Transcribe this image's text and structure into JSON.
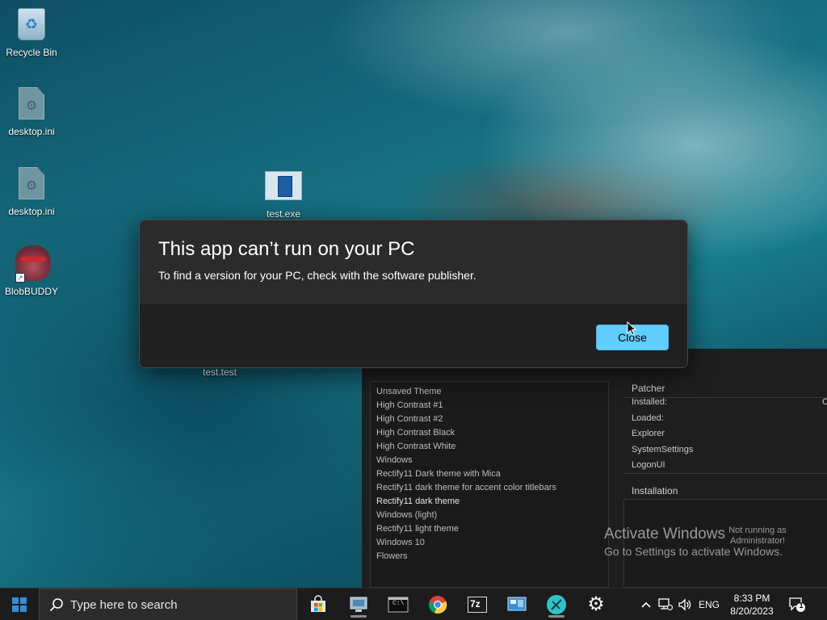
{
  "desktop": {
    "icons": [
      {
        "label": "Recycle Bin",
        "icon": "recycle-bin-icon"
      },
      {
        "label": "desktop.ini",
        "icon": "settings-file-icon"
      },
      {
        "label": "desktop.ini",
        "icon": "settings-file-icon"
      },
      {
        "label": "BlobBUDDY",
        "icon": "blobbuddy-icon"
      },
      {
        "label": "test.exe",
        "icon": "exe-file-icon"
      },
      {
        "label": "test.test",
        "icon": "unknown-file-icon"
      }
    ]
  },
  "dialog": {
    "title": "This app can’t run on your PC",
    "message": "To find a version for your PC, check with the software publisher.",
    "close_label": "Close"
  },
  "theme_app": {
    "themes": [
      "Unsaved Theme",
      "High Contrast #1",
      "High Contrast #2",
      "High Contrast Black",
      "High Contrast White",
      "Windows",
      "Rectify11 Dark theme with Mica",
      "Rectify11 dark theme for accent color titlebars",
      "Rectify11 dark theme",
      "Windows (light)",
      "Rectify11 light theme",
      "Windows 10",
      "Flowers"
    ],
    "patcher": {
      "heading": "Patcher",
      "rows": [
        "Installed:",
        "Loaded:",
        "Explorer",
        "SystemSettings",
        "LogonUI"
      ],
      "installed_value_partial": "C"
    },
    "installation": {
      "heading": "Installation",
      "status_line1": "Not running as",
      "status_line2": "Administrator!"
    }
  },
  "watermark": {
    "line1": "Activate Windows",
    "line2": "Go to Settings to activate Windows."
  },
  "taskbar": {
    "search_placeholder": "Type here to search",
    "apps": [
      "store-icon",
      "control-panel-icon",
      "command-prompt-icon",
      "chrome-icon",
      "7zip-icon",
      "display-settings-icon",
      "app-icon",
      "settings-icon"
    ],
    "cmd_text": "C:\\",
    "sevenzip_text": "7z",
    "language": "ENG",
    "time": "8:33 PM",
    "date": "8/20/2023",
    "notification_count": "1"
  },
  "colors": {
    "accent": "#60cdff",
    "dialog_bg": "#2b2b2b",
    "dialog_footer": "#202020",
    "taskbar": "#1c1c1c"
  }
}
